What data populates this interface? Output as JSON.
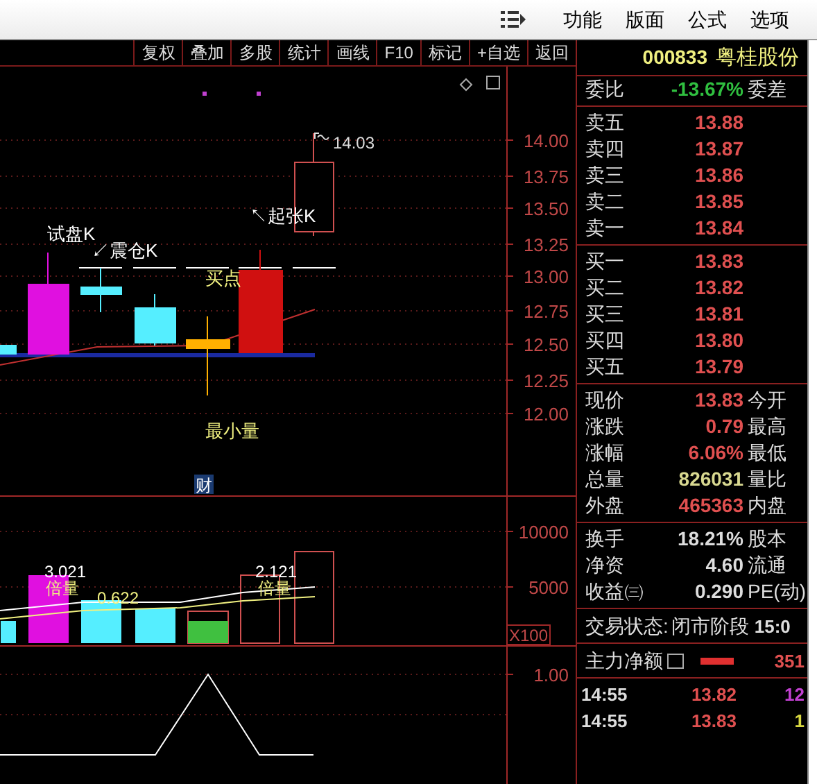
{
  "menubar": {
    "items": [
      "功能",
      "版面",
      "公式",
      "选项"
    ]
  },
  "toolbar": {
    "buttons": [
      "复权",
      "叠加",
      "多股",
      "统计",
      "画线",
      "F10",
      "标记",
      "+自选",
      "返回"
    ]
  },
  "price_chart": {
    "axis_labels": [
      "14.00",
      "13.75",
      "13.50",
      "13.25",
      "13.00",
      "12.75",
      "12.50",
      "12.25",
      "12.00"
    ],
    "high_label": "14.03",
    "badge": "财",
    "annotations": [
      {
        "kind": "signal",
        "text": "试盘K"
      },
      {
        "kind": "signal",
        "text": "↙震仓K"
      },
      {
        "kind": "point",
        "text": "买点"
      },
      {
        "kind": "signal",
        "text": "↖起张K"
      },
      {
        "kind": "point",
        "text": "最小量"
      }
    ]
  },
  "volume_chart": {
    "axis_labels": [
      "10000",
      "5000"
    ],
    "unit": "X100",
    "labels": [
      "3.021",
      "倍量",
      "0.622",
      "2.121",
      "倍量"
    ]
  },
  "indicator_chart": {
    "axis_labels": [
      "1.00"
    ]
  },
  "quote": {
    "code": "000833",
    "name": "粤桂股份",
    "ratio": {
      "label": "委比",
      "value": "-13.67%",
      "label2": "委差"
    },
    "asks": [
      {
        "label": "卖五",
        "price": "13.88"
      },
      {
        "label": "卖四",
        "price": "13.87"
      },
      {
        "label": "卖三",
        "price": "13.86"
      },
      {
        "label": "卖二",
        "price": "13.85"
      },
      {
        "label": "卖一",
        "price": "13.84"
      }
    ],
    "bids": [
      {
        "label": "买一",
        "price": "13.83"
      },
      {
        "label": "买二",
        "price": "13.82"
      },
      {
        "label": "买三",
        "price": "13.81"
      },
      {
        "label": "买四",
        "price": "13.80"
      },
      {
        "label": "买五",
        "price": "13.79"
      }
    ],
    "stats": [
      {
        "label": "现价",
        "value": "13.83",
        "label2": "今开",
        "color": "#e05050"
      },
      {
        "label": "涨跌",
        "value": "0.79",
        "label2": "最高",
        "color": "#e05050"
      },
      {
        "label": "涨幅",
        "value": "6.06%",
        "label2": "最低",
        "color": "#e05050"
      },
      {
        "label": "总量",
        "value": "826031",
        "label2": "量比",
        "color": "#d8d890"
      },
      {
        "label": "外盘",
        "value": "465363",
        "label2": "内盘",
        "color": "#e05050"
      }
    ],
    "fundamentals": [
      {
        "label": "换手",
        "value": "18.21%",
        "label2": "股本"
      },
      {
        "label": "净资",
        "value": "4.60",
        "label2": "流通"
      },
      {
        "label": "收益㈢",
        "value": "0.290",
        "label2": "PE(动)"
      }
    ],
    "status": {
      "label": "交易状态:",
      "value": "闭市阶段",
      "time": "15:0"
    },
    "main_flow": {
      "label": "主力净额",
      "value": "351"
    },
    "ticks": [
      {
        "time": "14:55",
        "price": "13.82",
        "volume": "12",
        "color": "#c040d0"
      },
      {
        "time": "14:55",
        "price": "13.83",
        "volume": "1",
        "color": "#d8d840"
      }
    ]
  }
}
